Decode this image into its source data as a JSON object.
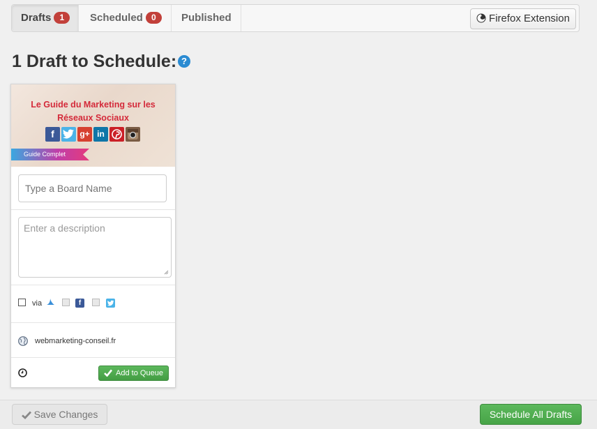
{
  "tabs": {
    "drafts": {
      "label": "Drafts",
      "count": "1"
    },
    "scheduled": {
      "label": "Scheduled",
      "count": "0"
    },
    "published": {
      "label": "Published"
    }
  },
  "extension_button": {
    "label": "Firefox Extension",
    "icon": "firefox-icon"
  },
  "heading": {
    "title": "1 Draft to Schedule:",
    "help_icon": "?"
  },
  "draft_card": {
    "thumbnail": {
      "title_line1": "Le Guide du Marketing sur les",
      "title_line2": "Réseaux Sociaux",
      "ribbon": "Guide Complet",
      "social_icons": [
        "facebook-icon",
        "twitter-icon",
        "google-plus-icon",
        "linkedin-icon",
        "pinterest-icon",
        "instagram-icon"
      ]
    },
    "board_input": {
      "placeholder": "Type a Board Name",
      "value": ""
    },
    "description_input": {
      "placeholder": "Enter a description",
      "value": ""
    },
    "share": {
      "via_label": "via"
    },
    "source_url": "webmarketing-conseil.fr",
    "add_to_queue_label": "Add to Queue"
  },
  "footer": {
    "save_label": "Save Changes",
    "schedule_all_label": "Schedule All Drafts"
  },
  "colors": {
    "badge": "#c2403a",
    "success": "#5cb85c",
    "help": "#2a8bd2"
  }
}
